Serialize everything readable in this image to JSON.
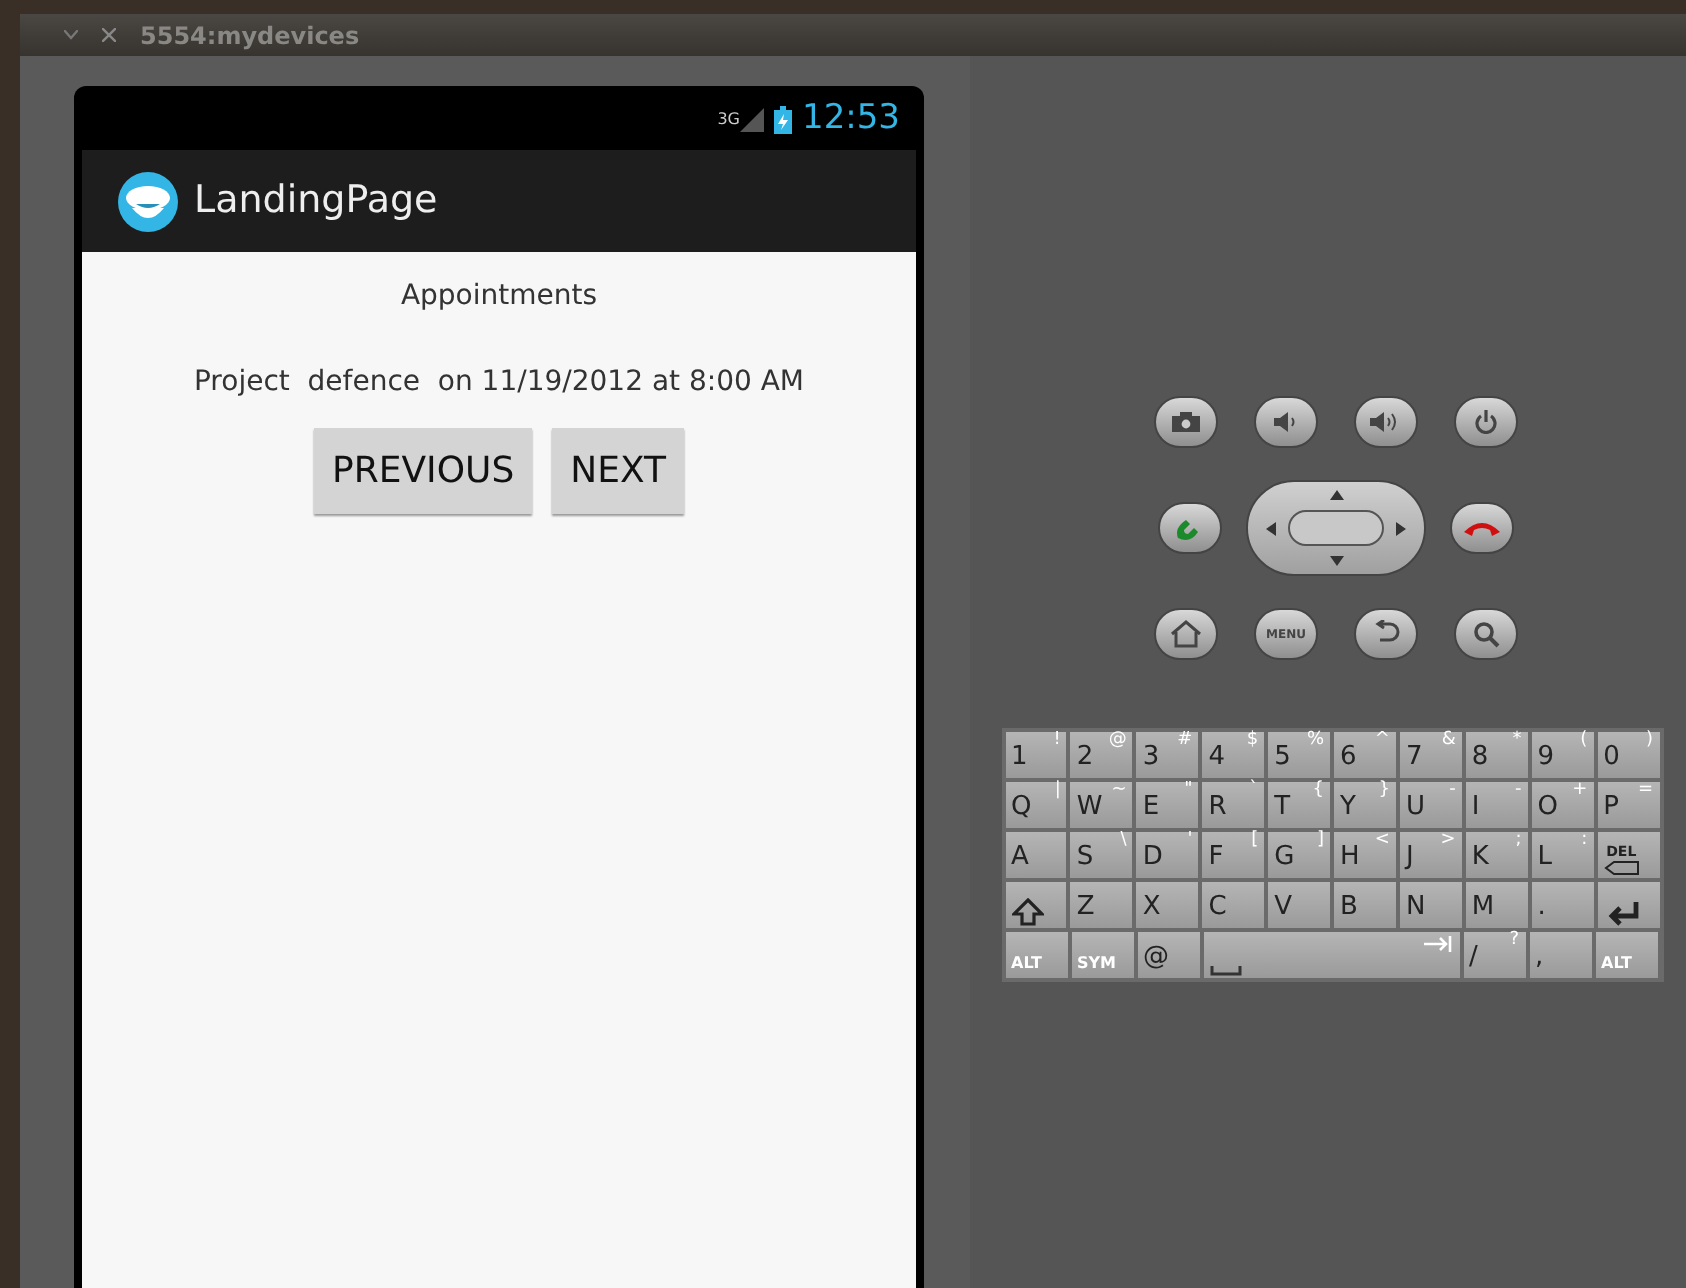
{
  "window": {
    "title": "5554:mydevices"
  },
  "status_bar": {
    "network": "3G",
    "time": "12:53"
  },
  "action_bar": {
    "title": "LandingPage"
  },
  "screen": {
    "heading": "Appointments",
    "appointment": "Project  defence  on 11/19/2012 at 8:00 AM",
    "buttons": [
      "PREVIOUS",
      "NEXT"
    ]
  },
  "controls": {
    "menu_label": "MENU"
  },
  "keyboard": {
    "rows": [
      [
        {
          "label": "1",
          "alt": "!"
        },
        {
          "label": "2",
          "alt": "@"
        },
        {
          "label": "3",
          "alt": "#"
        },
        {
          "label": "4",
          "alt": "$"
        },
        {
          "label": "5",
          "alt": "%"
        },
        {
          "label": "6",
          "alt": "^"
        },
        {
          "label": "7",
          "alt": "&"
        },
        {
          "label": "8",
          "alt": "*"
        },
        {
          "label": "9",
          "alt": "("
        },
        {
          "label": "0",
          "alt": ")"
        }
      ],
      [
        {
          "label": "Q",
          "alt": "|"
        },
        {
          "label": "W",
          "alt": "~"
        },
        {
          "label": "E",
          "alt": "\""
        },
        {
          "label": "R",
          "alt": "`"
        },
        {
          "label": "T",
          "alt": "{"
        },
        {
          "label": "Y",
          "alt": "}"
        },
        {
          "label": "U",
          "alt": "-"
        },
        {
          "label": "I",
          "alt": "-"
        },
        {
          "label": "O",
          "alt": "+"
        },
        {
          "label": "P",
          "alt": "="
        }
      ],
      [
        {
          "label": "A"
        },
        {
          "label": "S",
          "alt": "\\"
        },
        {
          "label": "D",
          "alt": "'"
        },
        {
          "label": "F",
          "alt": "["
        },
        {
          "label": "G",
          "alt": "]"
        },
        {
          "label": "H",
          "alt": "<"
        },
        {
          "label": "J",
          "alt": ">"
        },
        {
          "label": "K",
          "alt": ";"
        },
        {
          "label": "L",
          "alt": ":"
        },
        {
          "kind": "del",
          "label": "DEL"
        }
      ],
      [
        {
          "kind": "shift"
        },
        {
          "label": "Z"
        },
        {
          "label": "X"
        },
        {
          "label": "C"
        },
        {
          "label": "V"
        },
        {
          "label": "B"
        },
        {
          "label": "N"
        },
        {
          "label": "M"
        },
        {
          "label": "."
        },
        {
          "kind": "enter"
        }
      ]
    ],
    "bottom_row": [
      {
        "label": "ALT",
        "kind": "small"
      },
      {
        "label": "SYM",
        "kind": "small"
      },
      {
        "label": "@"
      },
      {
        "kind": "space"
      },
      {
        "label": "/",
        "alt": "?"
      },
      {
        "label": ","
      },
      {
        "label": "ALT",
        "kind": "small"
      }
    ]
  }
}
